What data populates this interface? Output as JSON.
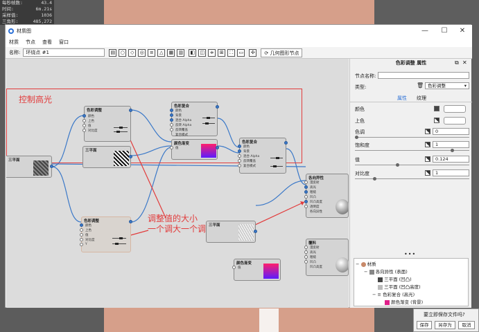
{
  "stats": [
    {
      "label": "每秒帧数:",
      "value": "43.4"
    },
    {
      "label": "时间:",
      "value": "6m.21s"
    },
    {
      "label": "采样值:",
      "value": "1036"
    },
    {
      "label": "三角形:",
      "value": "485,272"
    }
  ],
  "window": {
    "title": "材质图",
    "minimize": "—",
    "maximize": "☐",
    "close": "✕"
  },
  "menu": [
    "材质",
    "节点",
    "查看",
    "窗口"
  ],
  "toolbar": {
    "name_label": "名称:",
    "name_value": "环绕点 #1",
    "geo_button": "几何图形节点"
  },
  "annotations": {
    "highlight": "控制高光",
    "adjust_line1": "调整值的大小",
    "adjust_line2": "一个调大一个调小"
  },
  "nodes": {
    "color_adjust_top": {
      "title": "色彩调整",
      "ports": [
        "颜色",
        "上色",
        "值",
        "对比度"
      ]
    },
    "three_plane_a": {
      "title": "三平面"
    },
    "mix_a": {
      "title": "色彩复合",
      "ports": [
        "颜色",
        "背景",
        "混合 Alpha",
        "反转 Alpha",
        "反转覆盖",
        "复合模式"
      ]
    },
    "gradient_a": {
      "title": "颜色渐变",
      "ports": [
        "值"
      ]
    },
    "mix_b": {
      "title": "色彩复合",
      "ports": [
        "颜色",
        "背景",
        "混合 Alpha",
        "反转覆盖",
        "复合模式"
      ]
    },
    "left_node": {
      "title": "三平面"
    },
    "diffuse": {
      "title": "各向异性",
      "ports": [
        "漫反射",
        "高光",
        "粗糙",
        "凹凸",
        "凹凸高度",
        "透明度",
        "各向异性"
      ]
    },
    "color_adjust_bottom": {
      "title": "色彩调整",
      "ports": [
        "颜色",
        "上色",
        "值",
        "对比度",
        "Y"
      ]
    },
    "three_plane_b": {
      "title": "三平面"
    },
    "gradient_b": {
      "title": "颜色渐变",
      "ports": [
        "值"
      ]
    },
    "material": {
      "title": "覆料",
      "ports": [
        "漫反射",
        "高光",
        "粗糙",
        "凹凸",
        "凹凸高度"
      ]
    }
  },
  "panel": {
    "title": "色彩调整 属性",
    "node_name_label": "节点名称:",
    "node_name_value": "",
    "type_label": "类型:",
    "type_value": "色彩调整",
    "tab_props": "属性",
    "tab_texture": "纹理",
    "rows": [
      {
        "label": "颜色"
      },
      {
        "label": "上色"
      },
      {
        "label": "色调",
        "value": "0"
      },
      {
        "label": "饱和度",
        "value": "1"
      },
      {
        "label": "值",
        "value": "0.124"
      },
      {
        "label": "对比度",
        "value": "1"
      }
    ],
    "more": "•••"
  },
  "tree": [
    {
      "text": "材质",
      "level": 0
    },
    {
      "text": "各向异性 (表面)",
      "level": 1
    },
    {
      "text": "三平面 (凹凸)",
      "level": 2
    },
    {
      "text": "三平面 (凹凸高度)",
      "level": 2
    },
    {
      "text": "色彩复合 (高光)",
      "level": 2
    },
    {
      "text": "颜色渐变 (背景)",
      "level": 3
    }
  ],
  "dialog": {
    "message": "要立即保存文件吗?",
    "save": "保存",
    "save_as": "另存为",
    "cancel": "取消"
  },
  "colors": {
    "accent": "#2a6fd6",
    "annotation": "#e23b3b",
    "wire": "#3a78c8"
  }
}
